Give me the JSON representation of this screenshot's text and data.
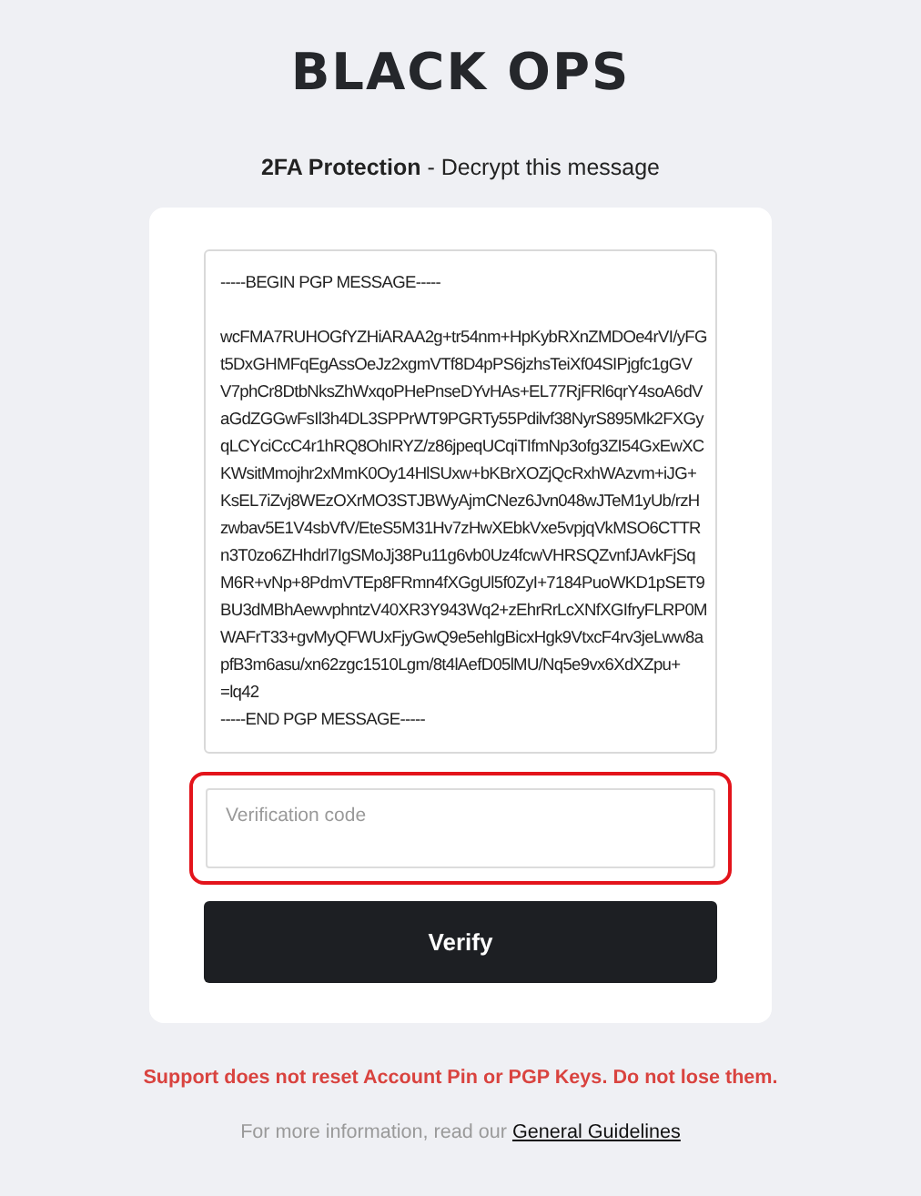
{
  "logo": {
    "text": "BLACK OPS"
  },
  "heading": {
    "title": "**2FA Protection** - Decrypt this message"
  },
  "message": {
    "header": "-----BEGIN PGP MESSAGE-----",
    "lines": [
      "wcFMA7RUHOGfYZHiARAA2g+tr54nm+HpKybRXnZMDOe4rVI/yFG",
      "t5DxGHMFqEgAssOeJz2xgmVTf8D4pPS6jzhsTeiXf04SIPjgfc1gGV",
      "V7phCr8DtbNksZhWxqoPHePnseDYvHAs+EL77RjFRl6qrY4soA6dV",
      "aGdZGGwFsIl3h4DL3SPPrWT9PGRTy55Pdilvf38NyrS895Mk2FXGy",
      "qLCYciCcC4r1hRQ8OhIRYZ/z86jpeqUCqiTIfmNp3ofg3ZI54GxEwXC",
      "KWsitMmojhr2xMmK0Oy14HlSUxw+bKBrXOZjQcRxhWAzvm+iJG+",
      "KsEL7iZvj8WEzOXrMO3STJBWyAjmCNez6Jvn048wJTeM1yUb/rzH",
      "zwbav5E1V4sbVfV/EteS5M31Hv7zHwXEbkVxe5vpjqVkMSO6CTTR",
      "n3T0zo6ZHhdrl7IgSMoJj38Pu11g6vb0Uz4fcwVHRSQZvnfJAvkFjSq",
      "M6R+vNp+8PdmVTEp8FRmn4fXGgUl5f0ZyI+7184PuoWKD1pSET9",
      "BU3dMBhAewvphntzV40XR3Y943Wq2+zEhrRrLcXNfXGIfryFLRP0M",
      "WAFrT33+gvMyQFWUxFjyGwQ9e5ehlgBicxHgk9VtxcF4rv3jeLww8a",
      "pfB3m6asu/xn62zgc1510Lgm/8t4lAefD05lMU/Nq5e9vx6XdXZpu+",
      "=lq42"
    ],
    "footer": "-----END PGP MESSAGE-----"
  },
  "verification": {
    "placeholder": "Verification code",
    "highlighted": true
  },
  "verify_button": {
    "label": "Verify"
  },
  "warning": "Support does not reset Account Pin or PGP Keys. Do not lose them.",
  "info": {
    "text": "For more information, read our",
    "link": "General Guidelines"
  }
}
